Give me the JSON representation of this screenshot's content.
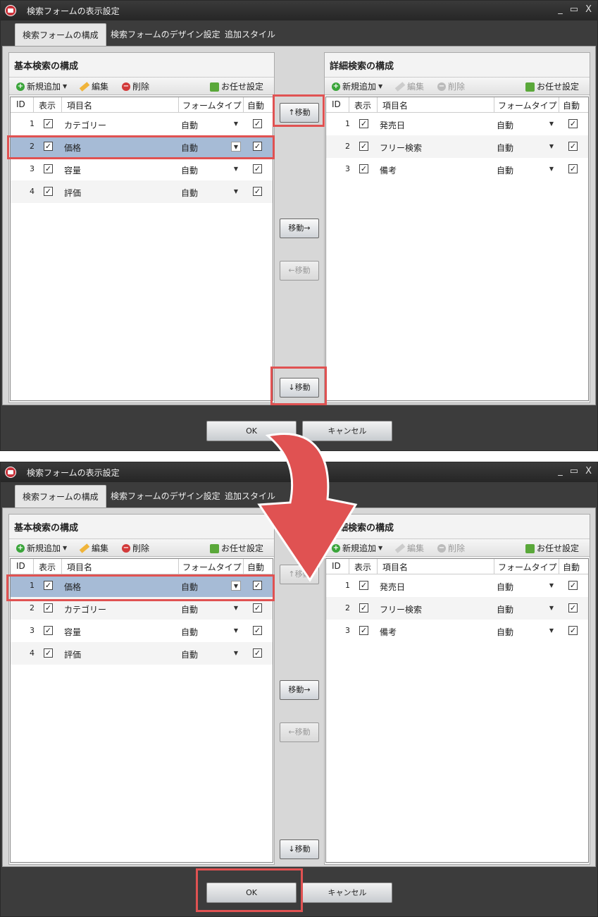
{
  "window": {
    "title": "検索フォームの表示設定",
    "controls": [
      "_",
      "▭",
      "X"
    ]
  },
  "tabs": [
    "検索フォームの構成",
    "検索フォームのデザイン設定",
    "追加スタイル"
  ],
  "basic_panel": {
    "title": "基本検索の構成",
    "toolbar": {
      "add": "新規追加",
      "edit": "編集",
      "delete": "削除",
      "auto": "お任せ設定"
    }
  },
  "detail_panel": {
    "title": "詳細検索の構成",
    "toolbar": {
      "add": "新規追加",
      "edit": "編集",
      "delete": "削除",
      "auto": "お任せ設定"
    }
  },
  "columns": [
    "ID",
    "表示",
    "項目名",
    "フォームタイプ",
    "自動"
  ],
  "move_buttons": {
    "up": "↑移動",
    "right": "移動→",
    "left": "←移動",
    "down": "↓移動"
  },
  "footer": {
    "ok": "OK",
    "cancel": "キャンセル"
  },
  "before": {
    "basic_rows": [
      {
        "id": "1",
        "shown": true,
        "name": "カテゴリー",
        "form_type": "自動",
        "auto": true,
        "selected": false
      },
      {
        "id": "2",
        "shown": true,
        "name": "価格",
        "form_type": "自動",
        "auto": true,
        "selected": true
      },
      {
        "id": "3",
        "shown": true,
        "name": "容量",
        "form_type": "自動",
        "auto": true,
        "selected": false
      },
      {
        "id": "4",
        "shown": true,
        "name": "評価",
        "form_type": "自動",
        "auto": true,
        "selected": false
      }
    ],
    "detail_rows": [
      {
        "id": "1",
        "shown": true,
        "name": "発売日",
        "form_type": "自動",
        "auto": true
      },
      {
        "id": "2",
        "shown": true,
        "name": "フリー検索",
        "form_type": "自動",
        "auto": true
      },
      {
        "id": "3",
        "shown": true,
        "name": "備考",
        "form_type": "自動",
        "auto": true
      }
    ]
  },
  "after": {
    "basic_rows": [
      {
        "id": "1",
        "shown": true,
        "name": "価格",
        "form_type": "自動",
        "auto": true,
        "selected": true
      },
      {
        "id": "2",
        "shown": true,
        "name": "カテゴリー",
        "form_type": "自動",
        "auto": true,
        "selected": false
      },
      {
        "id": "3",
        "shown": true,
        "name": "容量",
        "form_type": "自動",
        "auto": true,
        "selected": false
      },
      {
        "id": "4",
        "shown": true,
        "name": "評価",
        "form_type": "自動",
        "auto": true,
        "selected": false
      }
    ],
    "detail_rows": [
      {
        "id": "1",
        "shown": true,
        "name": "発売日",
        "form_type": "自動",
        "auto": true
      },
      {
        "id": "2",
        "shown": true,
        "name": "フリー検索",
        "form_type": "自動",
        "auto": true
      },
      {
        "id": "3",
        "shown": true,
        "name": "備考",
        "form_type": "自動",
        "auto": true
      }
    ]
  },
  "colors": {
    "highlight": "#e05252",
    "selected_row": "#a6bbd6",
    "window_bg": "#3c3c3c"
  }
}
